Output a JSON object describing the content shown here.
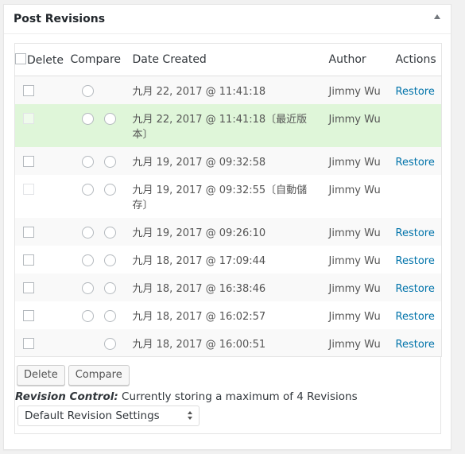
{
  "postbox": {
    "title": "Post Revisions",
    "toggle_icon": "triangle-up-icon"
  },
  "table": {
    "headers": {
      "delete": "Delete",
      "compare": "Compare",
      "date": "Date Created",
      "author": "Author",
      "actions": "Actions"
    },
    "rows": [
      {
        "date": "九月 22, 2017 @ 11:41:18",
        "author": "Jimmy Wu",
        "action": "Restore",
        "checkbox": "enabled",
        "radios": "first-only",
        "style": "alt"
      },
      {
        "date": "九月 22, 2017 @ 11:41:18〔最近版本〕",
        "author": "Jimmy Wu",
        "action": "",
        "checkbox": "disabled",
        "radios": "both",
        "style": "current"
      },
      {
        "date": "九月 19, 2017 @ 09:32:58",
        "author": "Jimmy Wu",
        "action": "Restore",
        "checkbox": "enabled",
        "radios": "both",
        "style": "alt"
      },
      {
        "date": "九月 19, 2017 @ 09:32:55〔自動儲存〕",
        "author": "Jimmy Wu",
        "action": "",
        "checkbox": "disabled",
        "radios": "both",
        "style": "plain"
      },
      {
        "date": "九月 19, 2017 @ 09:26:10",
        "author": "Jimmy Wu",
        "action": "Restore",
        "checkbox": "enabled",
        "radios": "both",
        "style": "alt"
      },
      {
        "date": "九月 18, 2017 @ 17:09:44",
        "author": "Jimmy Wu",
        "action": "Restore",
        "checkbox": "enabled",
        "radios": "both",
        "style": "plain"
      },
      {
        "date": "九月 18, 2017 @ 16:38:46",
        "author": "Jimmy Wu",
        "action": "Restore",
        "checkbox": "enabled",
        "radios": "both",
        "style": "alt"
      },
      {
        "date": "九月 18, 2017 @ 16:02:57",
        "author": "Jimmy Wu",
        "action": "Restore",
        "checkbox": "enabled",
        "radios": "both",
        "style": "plain"
      },
      {
        "date": "九月 18, 2017 @ 16:00:51",
        "author": "Jimmy Wu",
        "action": "Restore",
        "checkbox": "enabled",
        "radios": "second-only",
        "style": "alt"
      }
    ]
  },
  "buttons": {
    "delete": "Delete",
    "compare": "Compare"
  },
  "note": {
    "label": "Revision Control:",
    "text": " Currently storing a maximum of 4 Revisions"
  },
  "select": {
    "selected": "Default Revision Settings"
  },
  "colors": {
    "link": "#0073aa",
    "current_row": "#dff6d9",
    "alt_row": "#f9f9f9"
  }
}
